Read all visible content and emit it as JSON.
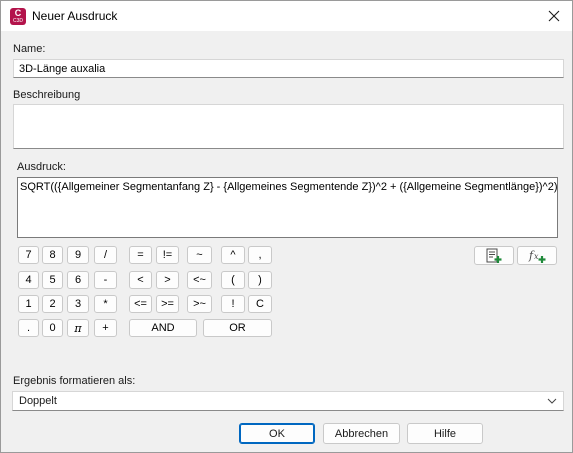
{
  "window": {
    "title": "Neuer Ausdruck",
    "app_icon_letter": "C",
    "app_icon_sub": "C3D"
  },
  "name": {
    "label": "Name:",
    "value": "3D-Länge auxalia"
  },
  "description": {
    "label": "Beschreibung",
    "value": ""
  },
  "expression": {
    "label": "Ausdruck:",
    "value": "SQRT(({Allgemeiner Segmentanfang Z} - {Allgemeines Segmentende Z})^2 + ({Allgemeine Segmentlänge})^2)"
  },
  "keypad": {
    "row1": [
      "7",
      "8",
      "9",
      "/",
      "=",
      "!=",
      "~",
      "^",
      ","
    ],
    "row2": [
      "4",
      "5",
      "6",
      "-",
      "<",
      ">",
      "<~",
      "(",
      ")"
    ],
    "row3": [
      "1",
      "2",
      "3",
      "*",
      "<=",
      ">=",
      ">~",
      "!",
      "C"
    ],
    "row4": [
      ".",
      "0",
      "π",
      "+",
      "AND",
      "OR"
    ]
  },
  "toolbar": {
    "insert_property_icon": "insert-property-icon",
    "insert_function_icon": "insert-function-icon"
  },
  "format": {
    "label": "Ergebnis formatieren als:",
    "selected": "Doppelt"
  },
  "buttons": {
    "ok": "OK",
    "cancel": "Abbrechen",
    "help": "Hilfe"
  },
  "colors": {
    "app_icon": "#b3134b",
    "accent": "#0067c0",
    "add_badge": "#1f8a3a"
  }
}
